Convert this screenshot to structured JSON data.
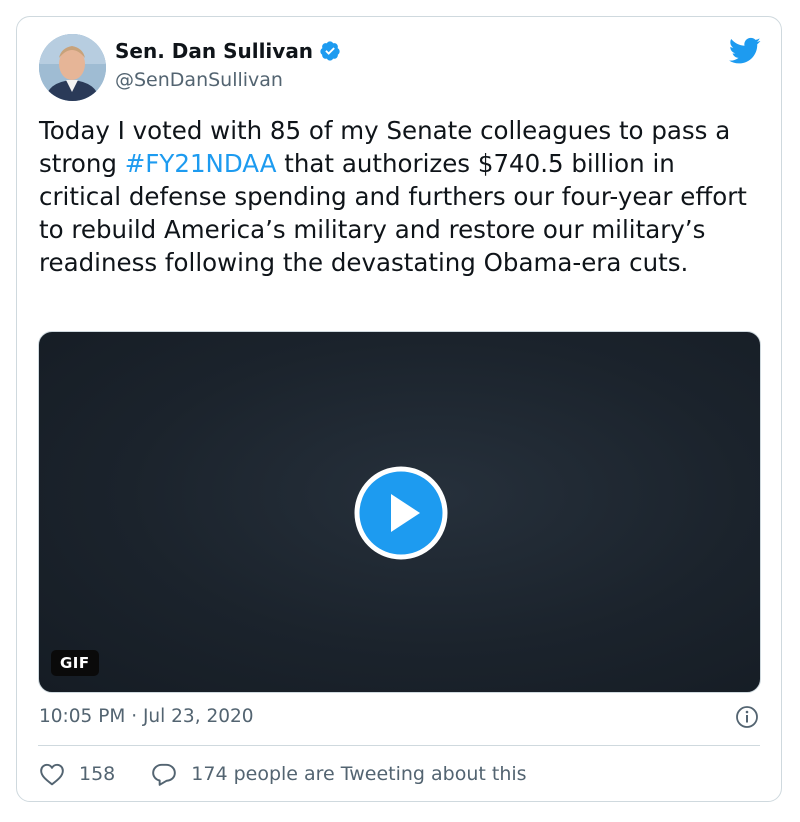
{
  "author": {
    "name": "Sen. Dan Sullivan",
    "handle": "@SenDanSullivan",
    "verified": true
  },
  "tweet": {
    "text_before": "Today I voted with 85 of my Senate colleagues to pass a strong ",
    "hashtag": "#FY21NDAA",
    "text_after": " that authorizes $740.5 billion in critical defense spending and furthers our four-year effort to rebuild America’s military and restore our military’s readiness following the devastating Obama-era cuts."
  },
  "media": {
    "badge": "GIF"
  },
  "meta": {
    "timestamp": "10:05 PM · Jul 23, 2020"
  },
  "actions": {
    "likes": "158",
    "conversation": "174 people are Tweeting about this"
  },
  "colors": {
    "accent": "#1d9bf0",
    "text": "#0f1419",
    "muted": "#536471",
    "border": "#cfd9de"
  },
  "icons": {
    "brand": "twitter-bird-icon",
    "verified": "verified-badge-icon",
    "play": "play-icon",
    "info": "info-icon",
    "like": "heart-icon",
    "reply": "speech-bubble-icon"
  }
}
